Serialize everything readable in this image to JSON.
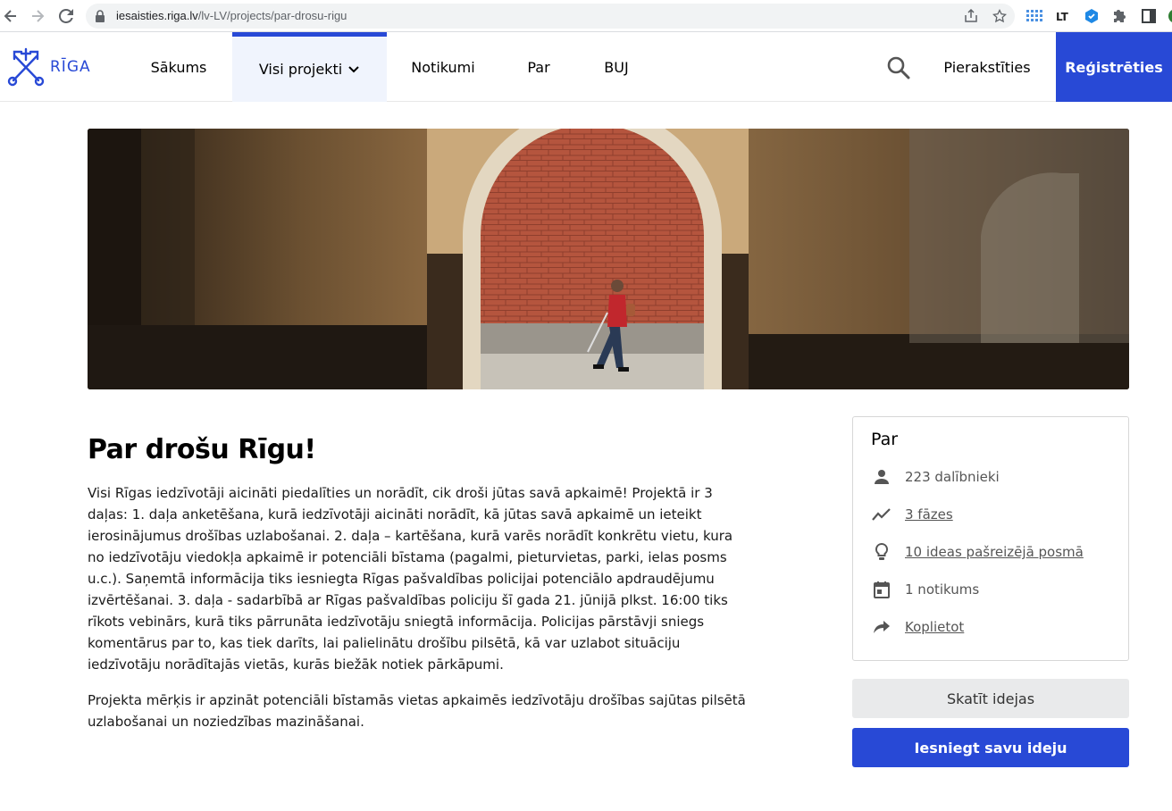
{
  "browser": {
    "url_domain": "iesaisties.riga.lv",
    "url_path": "/lv-LV/projects/par-drosu-rigu"
  },
  "site": {
    "logo_text": "RĪGA",
    "menu": [
      "Sākums",
      "Visi projekti",
      "Notikumi",
      "Par",
      "BUJ"
    ],
    "login": "Pierakstīties",
    "register": "Reģistrēties",
    "accent_color": "#2849d6"
  },
  "project": {
    "title": "Par drošu Rīgu!",
    "paragraphs": [
      "Visi Rīgas iedzīvotāji aicināti piedalīties un norādīt, cik droši jūtas savā apkaimē! Projektā ir 3 daļas: 1. daļa anketēšana, kurā iedzīvotāji aicināti norādīt, kā jūtas savā apkaimē un ieteikt ierosinājumus drošības uzlabošanai. 2. daļa – kartēšana, kurā varēs norādīt konkrētu vietu, kura no iedzīvotāju viedokļa apkaimē ir potenciāli bīstama (pagalmi, pieturvietas, parki, ielas posms u.c.). Saņemtā informācija tiks iesniegta Rīgas pašvaldības policijai potenciālo apdraudējumu izvērtēšanai. 3. daļa - sadarbībā ar Rīgas pašvaldības policiju šī gada 21. jūnijā plkst. 16:00 tiks rīkots vebinārs, kurā tiks pārrunāta iedzīvotāju sniegtā informācija. Policijas pārstāvji sniegs komentārus par to, kas tiek darīts, lai palielinātu drošību pilsētā, kā var uzlabot situāciju iedzīvotāju norādītajās vietās, kurās biežāk notiek pārkāpumi.",
      "Projekta mērķis ir apzināt potenciāli bīstamās vietas apkaimēs iedzīvotāju drošības sajūtas pilsētā uzlabošanai un noziedzības mazināšanai."
    ]
  },
  "about": {
    "title": "Par",
    "participants": "223 dalībnieki",
    "phases": "3 fāzes",
    "ideas": "10 ideas pašreizējā posmā",
    "events": "1 notikums",
    "share": "Koplietot"
  },
  "actions": {
    "view_ideas": "Skatīt idejas",
    "submit_idea": "Iesniegt savu ideju"
  }
}
